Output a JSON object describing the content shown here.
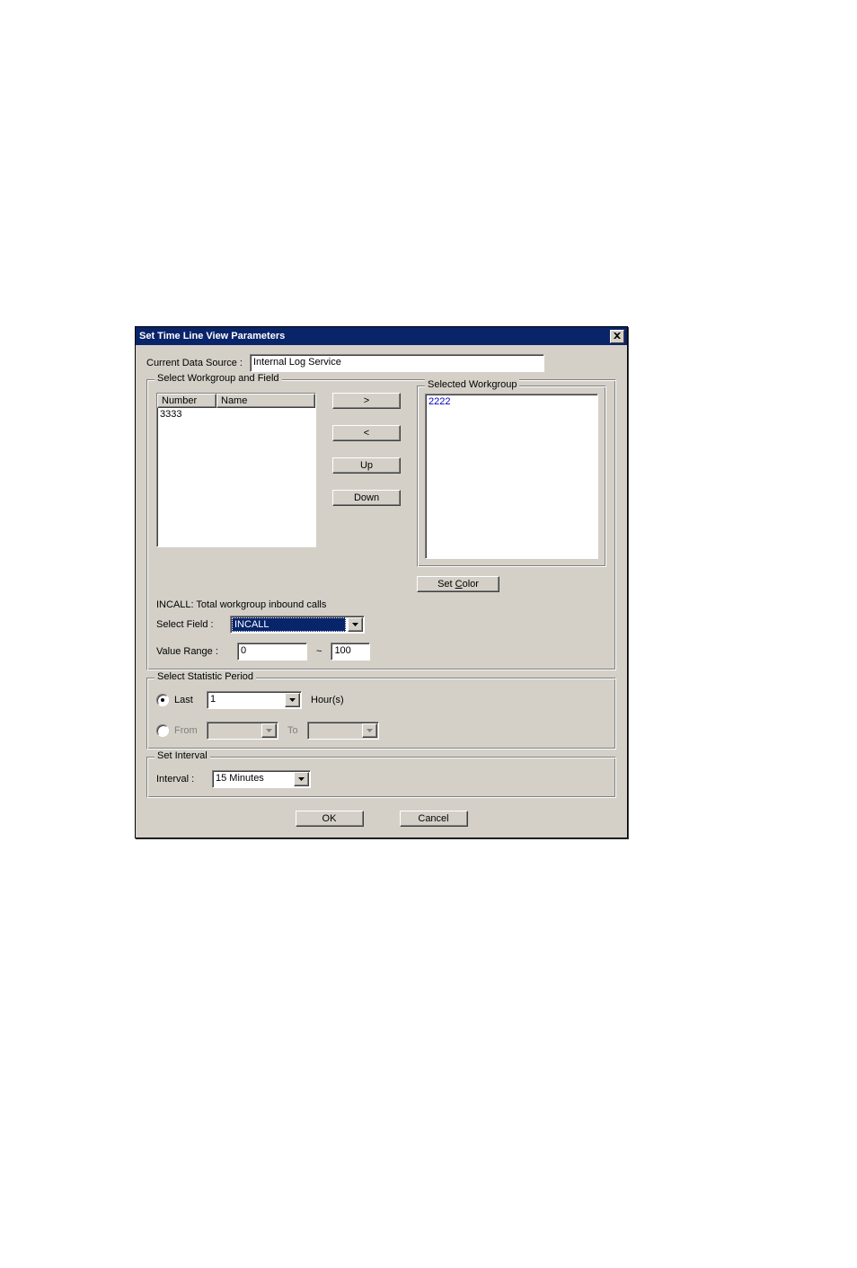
{
  "title": "Set Time Line View Parameters",
  "data_source": {
    "label": "Current Data Source :",
    "value": "Internal Log Service"
  },
  "workgroup_fieldset": {
    "legend": "Select Workgroup and Field",
    "available": {
      "columns": {
        "number": "Number",
        "name": "Name"
      },
      "rows": [
        {
          "number": "3333",
          "name": ""
        }
      ]
    },
    "buttons": {
      "add": ">",
      "remove": "<",
      "up": "Up",
      "down": "Down"
    },
    "selected": {
      "legend": "Selected Workgroup",
      "items": [
        "2222"
      ],
      "set_color_prefix": "Set ",
      "set_color_key": "C",
      "set_color_suffix": "olor"
    },
    "field": {
      "desc": "INCALL: Total workgroup inbound calls",
      "select_label": "Select Field :",
      "value": "INCALL"
    },
    "range": {
      "label": "Value Range :",
      "from": "0",
      "sep": "~",
      "to": "100"
    }
  },
  "period_fieldset": {
    "legend": "Select Statistic Period",
    "last": {
      "radio_label": "Last",
      "value": "1",
      "unit": "Hour(s)"
    },
    "from": {
      "radio_label": "From",
      "to_label": "To"
    }
  },
  "interval_fieldset": {
    "legend": "Set Interval",
    "label": "Interval :",
    "value": "15 Minutes"
  },
  "buttons": {
    "ok": "OK",
    "cancel": "Cancel"
  },
  "close_glyph": "✕"
}
